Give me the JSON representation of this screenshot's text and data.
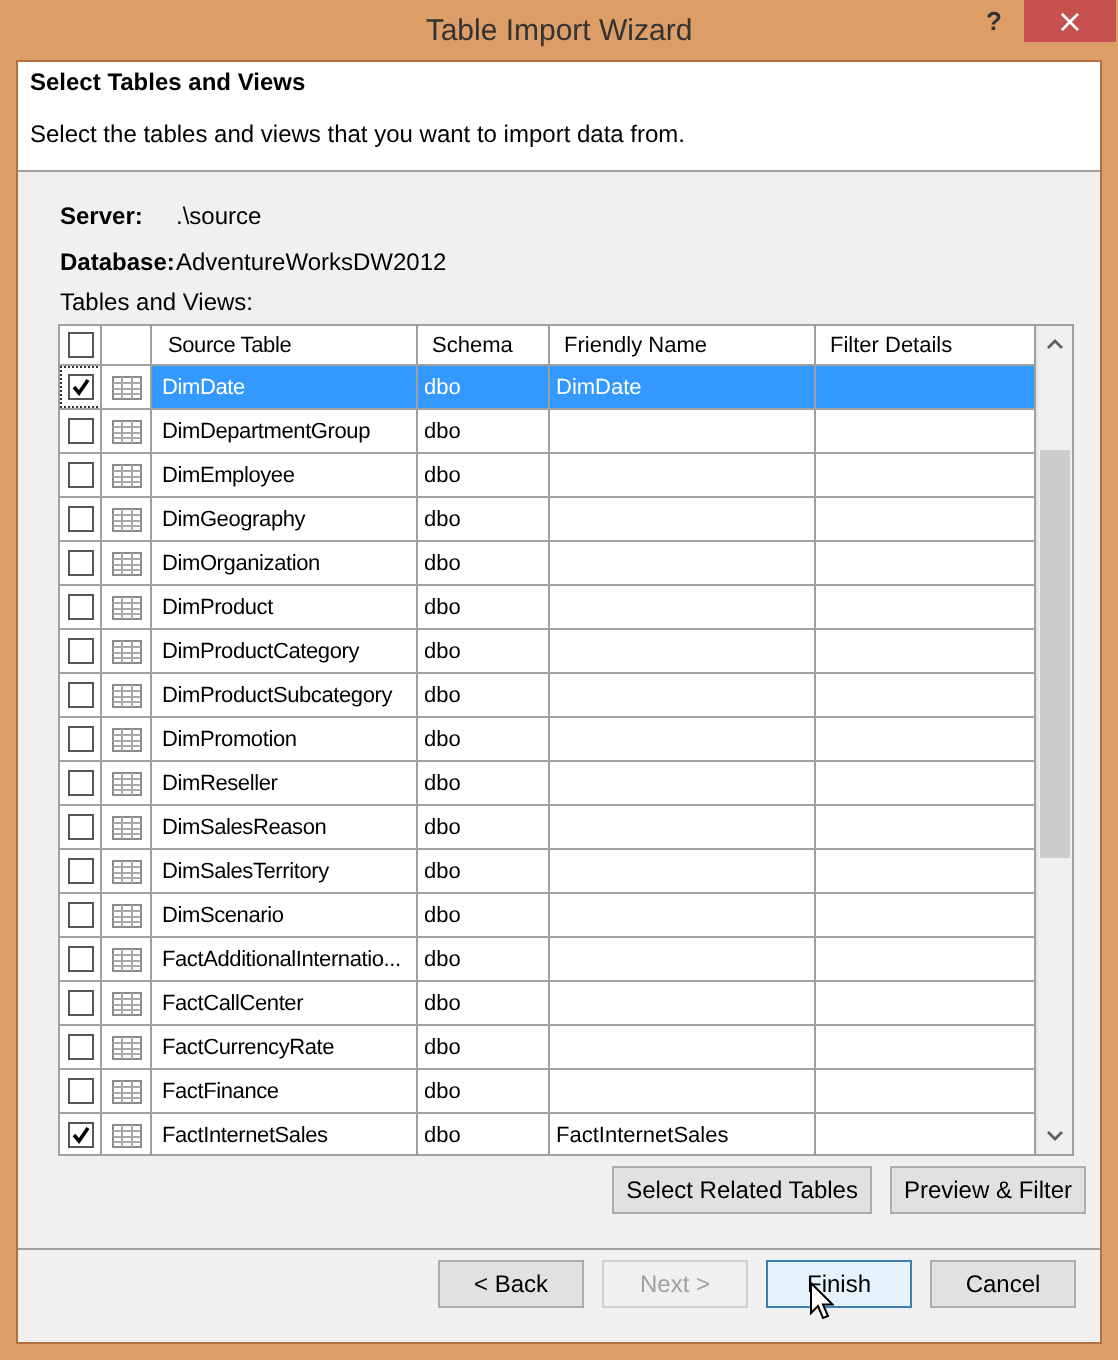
{
  "window": {
    "title": "Table Import Wizard",
    "help": "?",
    "close": "×"
  },
  "header": {
    "title": "Select Tables and Views",
    "subtitle": "Select the tables and views that you want to import data from."
  },
  "info": [
    {
      "label": "Server:",
      "value": ".\\source"
    },
    {
      "label": "Database:",
      "value": "AdventureWorksDW2012"
    }
  ],
  "table_label": "Tables and Views:",
  "table": {
    "select_all": {
      "checked": false
    },
    "columns": [
      "Source Table",
      "Schema",
      "Friendly Name",
      "Filter Details"
    ],
    "rows": [
      {
        "checked": true,
        "selected": true,
        "source": "DimDate",
        "schema": "dbo",
        "friendly": "DimDate"
      },
      {
        "checked": false,
        "selected": false,
        "source": "DimDepartmentGroup",
        "schema": "dbo"
      },
      {
        "checked": false,
        "selected": false,
        "source": "DimEmployee",
        "schema": "dbo"
      },
      {
        "checked": false,
        "selected": false,
        "source": "DimGeography",
        "schema": "dbo"
      },
      {
        "checked": false,
        "selected": false,
        "source": "DimOrganization",
        "schema": "dbo"
      },
      {
        "checked": false,
        "selected": false,
        "source": "DimProduct",
        "schema": "dbo"
      },
      {
        "checked": false,
        "selected": false,
        "source": "DimProductCategory",
        "schema": "dbo"
      },
      {
        "checked": false,
        "selected": false,
        "source": "DimProductSubcategory",
        "schema": "dbo"
      },
      {
        "checked": false,
        "selected": false,
        "source": "DimPromotion",
        "schema": "dbo"
      },
      {
        "checked": false,
        "selected": false,
        "source": "DimReseller",
        "schema": "dbo"
      },
      {
        "checked": false,
        "selected": false,
        "source": "DimSalesReason",
        "schema": "dbo"
      },
      {
        "checked": false,
        "selected": false,
        "source": "DimSalesTerritory",
        "schema": "dbo"
      },
      {
        "checked": false,
        "selected": false,
        "source": "DimScenario",
        "schema": "dbo"
      },
      {
        "checked": false,
        "selected": false,
        "source": "FactAdditionalInternatio...",
        "schema": "dbo"
      },
      {
        "checked": false,
        "selected": false,
        "source": "FactCallCenter",
        "schema": "dbo"
      },
      {
        "checked": false,
        "selected": false,
        "source": "FactCurrencyRate",
        "schema": "dbo"
      },
      {
        "checked": false,
        "selected": false,
        "source": "FactFinance",
        "schema": "dbo"
      },
      {
        "checked": true,
        "selected": false,
        "source": "FactInternetSales",
        "schema": "dbo",
        "friendly": "FactInternetSales"
      }
    ]
  },
  "table_buttons": [
    "Select Related Tables",
    "Preview & Filter"
  ],
  "nav_buttons": [
    {
      "label": "< Back",
      "disabled": false,
      "default": false
    },
    {
      "label": "Next >",
      "disabled": true,
      "default": false
    },
    {
      "label": "Finish",
      "disabled": false,
      "default": true
    },
    {
      "label": "Cancel",
      "disabled": false,
      "default": false
    }
  ]
}
